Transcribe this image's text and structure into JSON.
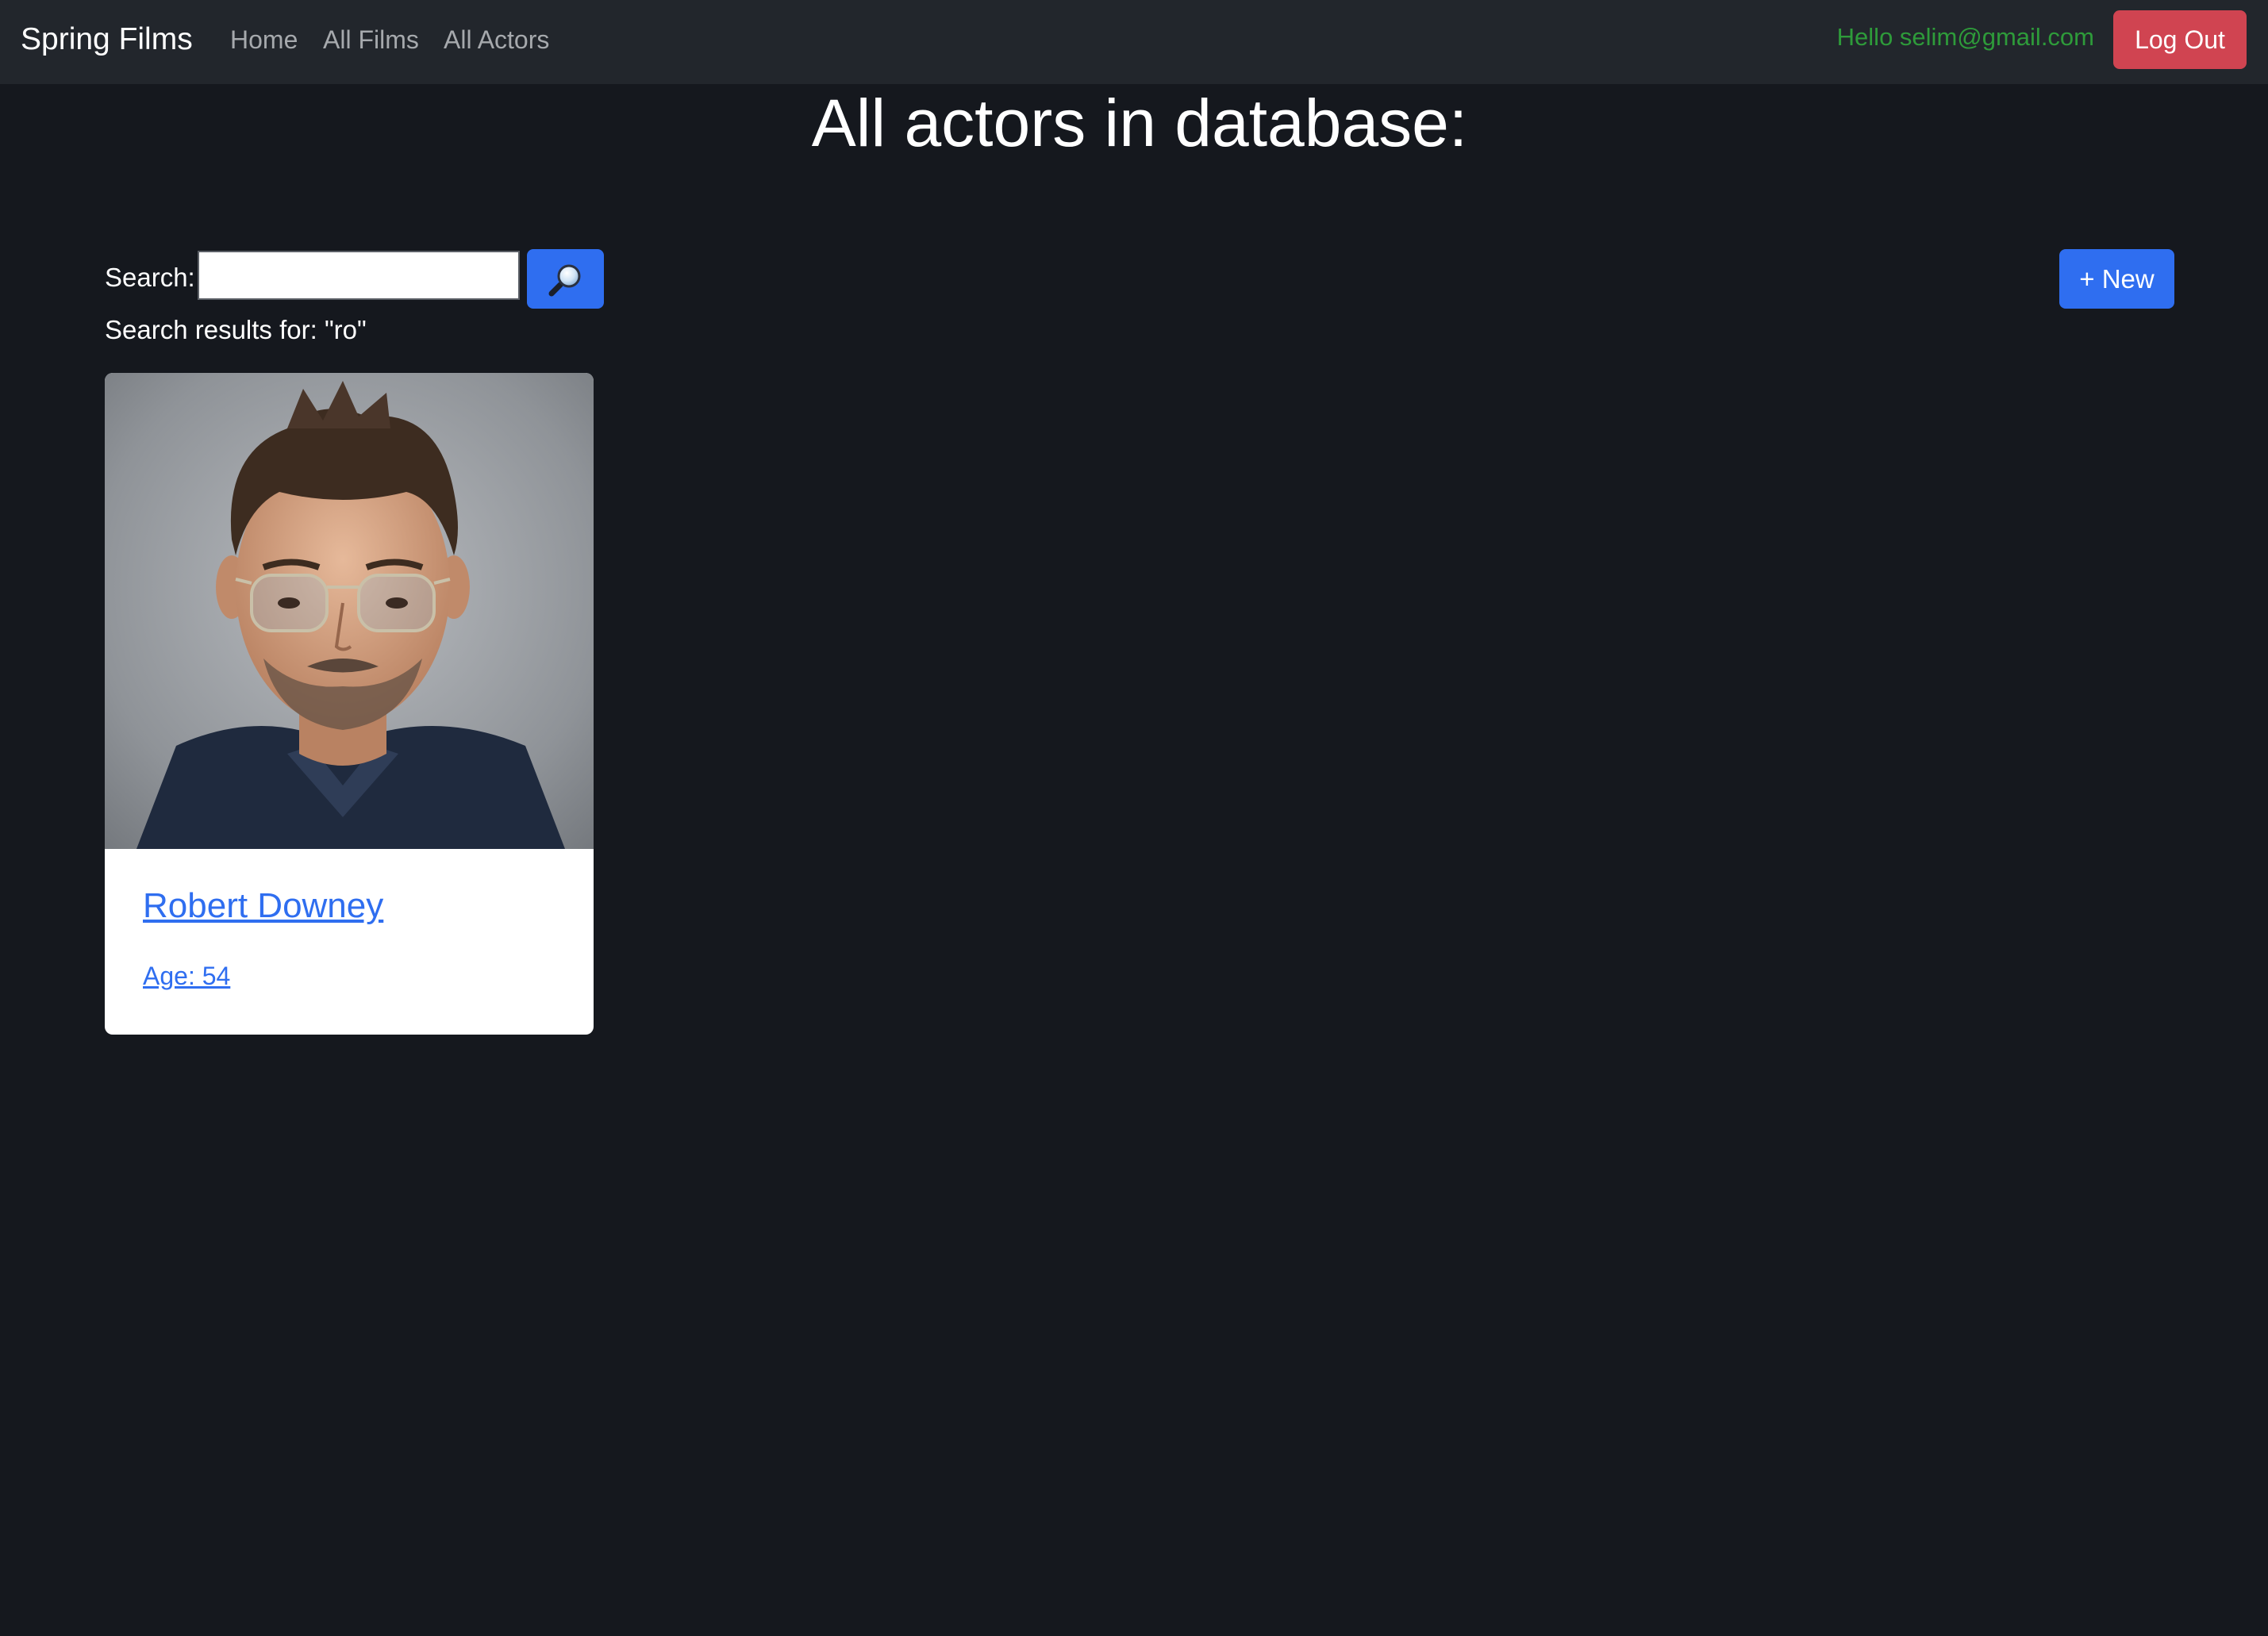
{
  "navbar": {
    "brand": "Spring Films",
    "links": [
      "Home",
      "All Films",
      "All Actors"
    ],
    "greeting": "Hello selim@gmail.com",
    "logout_label": "Log Out"
  },
  "page": {
    "title": "All actors in database:"
  },
  "search": {
    "label": "Search:",
    "value": "",
    "button_icon": "magnifier-icon",
    "results_text": "Search results for: \"ro\""
  },
  "toolbar": {
    "new_label": "+ New"
  },
  "actors": [
    {
      "name": "Robert Downey",
      "age_text": "Age: 54",
      "photo": "actor-portrait"
    }
  ],
  "colors": {
    "background": "#15181e",
    "navbar": "#22262c",
    "primary": "#2f6ef0",
    "danger": "#d04451",
    "greeting": "#2e9b3a"
  }
}
